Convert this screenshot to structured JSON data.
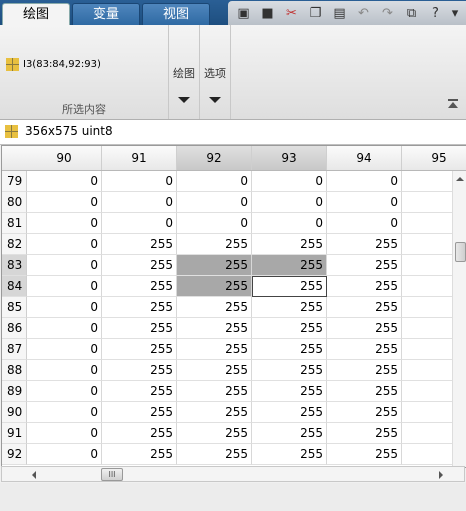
{
  "tabs": [
    {
      "label": "绘图",
      "active": true
    },
    {
      "label": "变量",
      "active": false
    },
    {
      "label": "视图",
      "active": false
    }
  ],
  "quick_access_icons": [
    "new-figure-icon",
    "save-icon",
    "cut-icon",
    "copy-icon",
    "paste-icon",
    "undo-icon",
    "redo-icon",
    "switch-windows-icon",
    "help-icon",
    "dropdown-icon"
  ],
  "ribbon": {
    "selection_item": "I3(83:84,92:93)",
    "selection_group_label": "所选内容",
    "plot_button_label": "绘图",
    "options_button_label": "选项"
  },
  "variable_info": "356x575 uint8",
  "table": {
    "columns": [
      "90",
      "91",
      "92",
      "93",
      "94",
      "95"
    ],
    "rows": [
      {
        "index": "79",
        "values": [
          "0",
          "0",
          "0",
          "0",
          "0",
          ""
        ]
      },
      {
        "index": "80",
        "values": [
          "0",
          "0",
          "0",
          "0",
          "0",
          ""
        ]
      },
      {
        "index": "81",
        "values": [
          "0",
          "0",
          "0",
          "0",
          "0",
          ""
        ]
      },
      {
        "index": "82",
        "values": [
          "0",
          "255",
          "255",
          "255",
          "255",
          ""
        ]
      },
      {
        "index": "83",
        "values": [
          "0",
          "255",
          "255",
          "255",
          "255",
          ""
        ]
      },
      {
        "index": "84",
        "values": [
          "0",
          "255",
          "255",
          "255",
          "255",
          ""
        ]
      },
      {
        "index": "85",
        "values": [
          "0",
          "255",
          "255",
          "255",
          "255",
          ""
        ]
      },
      {
        "index": "86",
        "values": [
          "0",
          "255",
          "255",
          "255",
          "255",
          ""
        ]
      },
      {
        "index": "87",
        "values": [
          "0",
          "255",
          "255",
          "255",
          "255",
          ""
        ]
      },
      {
        "index": "88",
        "values": [
          "0",
          "255",
          "255",
          "255",
          "255",
          ""
        ]
      },
      {
        "index": "89",
        "values": [
          "0",
          "255",
          "255",
          "255",
          "255",
          ""
        ]
      },
      {
        "index": "90",
        "values": [
          "0",
          "255",
          "255",
          "255",
          "255",
          ""
        ]
      },
      {
        "index": "91",
        "values": [
          "0",
          "255",
          "255",
          "255",
          "255",
          ""
        ]
      },
      {
        "index": "92",
        "values": [
          "0",
          "255",
          "255",
          "255",
          "255",
          ""
        ]
      }
    ],
    "selected_rows": [
      "83",
      "84"
    ],
    "selected_columns": [
      "92",
      "93"
    ]
  },
  "hscroll_thumb_label": "III"
}
